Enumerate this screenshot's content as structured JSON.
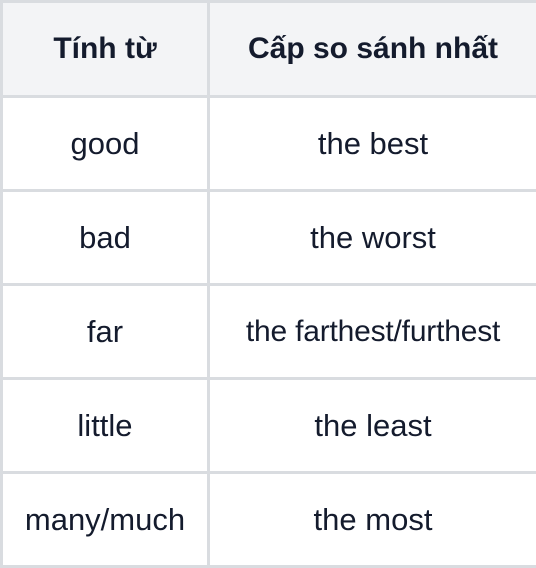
{
  "table": {
    "headers": [
      "Tính từ",
      "Cấp so sánh nhất"
    ],
    "rows": [
      [
        "good",
        "the best"
      ],
      [
        "bad",
        "the worst"
      ],
      [
        "far",
        "the farthest/furthest"
      ],
      [
        "little",
        "the least"
      ],
      [
        "many/much",
        "the most"
      ]
    ]
  },
  "colors": {
    "header_bg": "#f3f4f6",
    "border": "#d9dce0",
    "text": "#141b2d"
  }
}
